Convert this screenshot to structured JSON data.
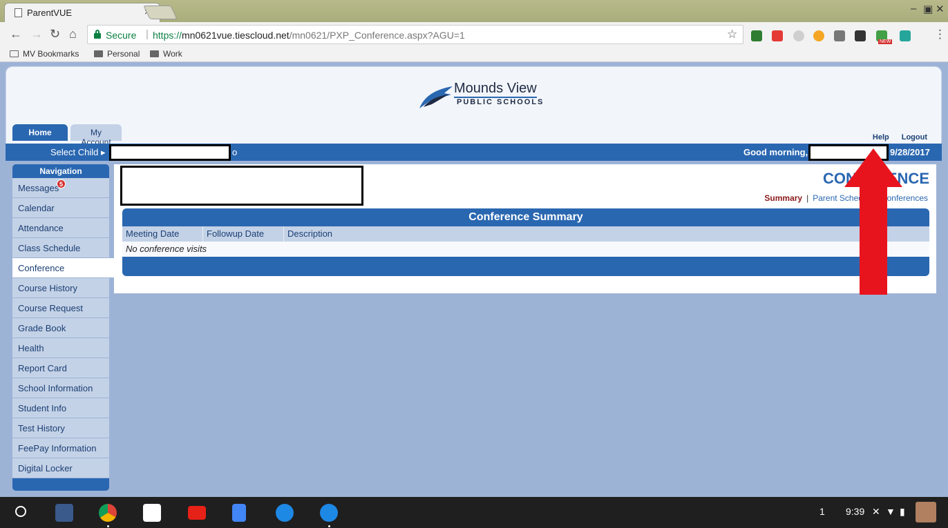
{
  "browser": {
    "tab_title": "ParentVUE",
    "tab_close": "×",
    "secure_label": "Secure",
    "url_scheme": "https://",
    "url_host": "mn0621vue.tiescloud.net",
    "url_path": "/mn0621/PXP_Conference.aspx?AGU=1",
    "new_badge": "NEW",
    "bookmarks": [
      "MV Bookmarks",
      "Personal",
      "Work"
    ]
  },
  "school": {
    "logo_line1": "Mounds View",
    "logo_line2": "PUBLIC SCHOOLS"
  },
  "tabs": [
    "Home",
    "My Account"
  ],
  "header_links": [
    "Help",
    "Logout"
  ],
  "bar": {
    "select_child": "Select Child ▸",
    "child_suffix": "o",
    "greeting": "Good morning,",
    "date": "9/28/2017"
  },
  "navigation": {
    "header": "Navigation",
    "items": [
      "Messages",
      "Calendar",
      "Attendance",
      "Class Schedule",
      "Conference",
      "Course History",
      "Course Request",
      "Grade Book",
      "Health",
      "Report Card",
      "School Information",
      "Student Info",
      "Test History",
      "FeePay Information",
      "Digital Locker"
    ],
    "messages_badge": "5",
    "active": "Conference"
  },
  "conference": {
    "title": "CONFERENCE",
    "summary_link": "Summary",
    "pipe": "|",
    "parent_link": "Parent Scheduled Conferences",
    "summary_title": "Conference Summary",
    "columns": [
      "Meeting Date",
      "Followup Date",
      "Description"
    ],
    "empty_message": "No conference visits"
  },
  "taskbar": {
    "notification_count": "1",
    "clock": "9:39"
  },
  "colors": {
    "accent": "#2a67b1",
    "nav_bg": "#c4d2e7",
    "page_bg": "#9db3d6",
    "arrow": "#e8141d"
  }
}
